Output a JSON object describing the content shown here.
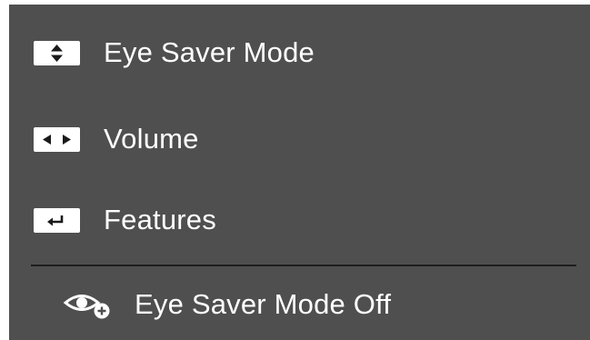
{
  "menu": {
    "items": [
      {
        "label": "Eye Saver Mode",
        "icon": "up-down-arrows-icon"
      },
      {
        "label": "Volume",
        "icon": "left-right-arrows-icon"
      },
      {
        "label": "Features",
        "icon": "enter-return-icon"
      }
    ]
  },
  "status": {
    "label": "Eye Saver Mode Off",
    "icon": "eye-saver-icon"
  },
  "colors": {
    "panel_background": "#4f4f4f",
    "text": "#ffffff",
    "divider": "#1e1e1e",
    "icon_background": "#ffffff",
    "icon_glyph": "#1a1a1a"
  }
}
